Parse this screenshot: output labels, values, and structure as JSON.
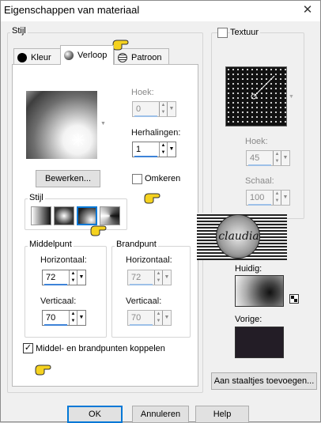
{
  "window": {
    "title": "Eigenschappen van materiaal",
    "close_glyph": "✕"
  },
  "stijl_group": {
    "label": "Stijl"
  },
  "tabs": [
    {
      "label": "Kleur",
      "icon": "black-circle-icon",
      "active": false
    },
    {
      "label": "Verloop",
      "icon": "gradient-circle-icon",
      "active": true
    },
    {
      "label": "Patroon",
      "icon": "pattern-globe-icon",
      "active": false
    }
  ],
  "gradient": {
    "hoek_label": "Hoek:",
    "hoek_value": "0",
    "herhalingen_label": "Herhalingen:",
    "herhalingen_value": "1",
    "edit_button": "Bewerken...",
    "omkeren_label": "Omkeren",
    "omkeren_checked": false,
    "style_label": "Stijl",
    "style_options": [
      "linear-style-icon",
      "rectangular-style-icon",
      "sunburst-style-icon",
      "radial-style-icon"
    ],
    "selected_style_index": 2
  },
  "middelpunt": {
    "label": "Middelpunt",
    "horizontaal_label": "Horizontaal:",
    "horizontaal_value": "72",
    "verticaal_label": "Verticaal:",
    "verticaal_value": "70"
  },
  "brandpunt": {
    "label": "Brandpunt",
    "horizontaal_label": "Horizontaal:",
    "horizontaal_value": "72",
    "verticaal_label": "Verticaal:",
    "verticaal_value": "70"
  },
  "link_points": {
    "label": "Middel- en brandpunten koppelen",
    "checked": true
  },
  "texture": {
    "checkbox_label": "Textuur",
    "checked": false,
    "hoek_label": "Hoek:",
    "hoek_value": "45",
    "schaal_label": "Schaal:",
    "schaal_value": "100"
  },
  "previews": {
    "current_label": "Huidig:",
    "previous_label": "Vorige:",
    "previous_color": "#231d26"
  },
  "watermark": {
    "text": "claudia"
  },
  "buttons": {
    "add_swatch": "Aan staaltjes toevoegen...",
    "ok": "OK",
    "cancel": "Annuleren",
    "help": "Help"
  },
  "colors": {
    "accent": "#0078d7",
    "pointer_yellow": "#f5d21f"
  }
}
